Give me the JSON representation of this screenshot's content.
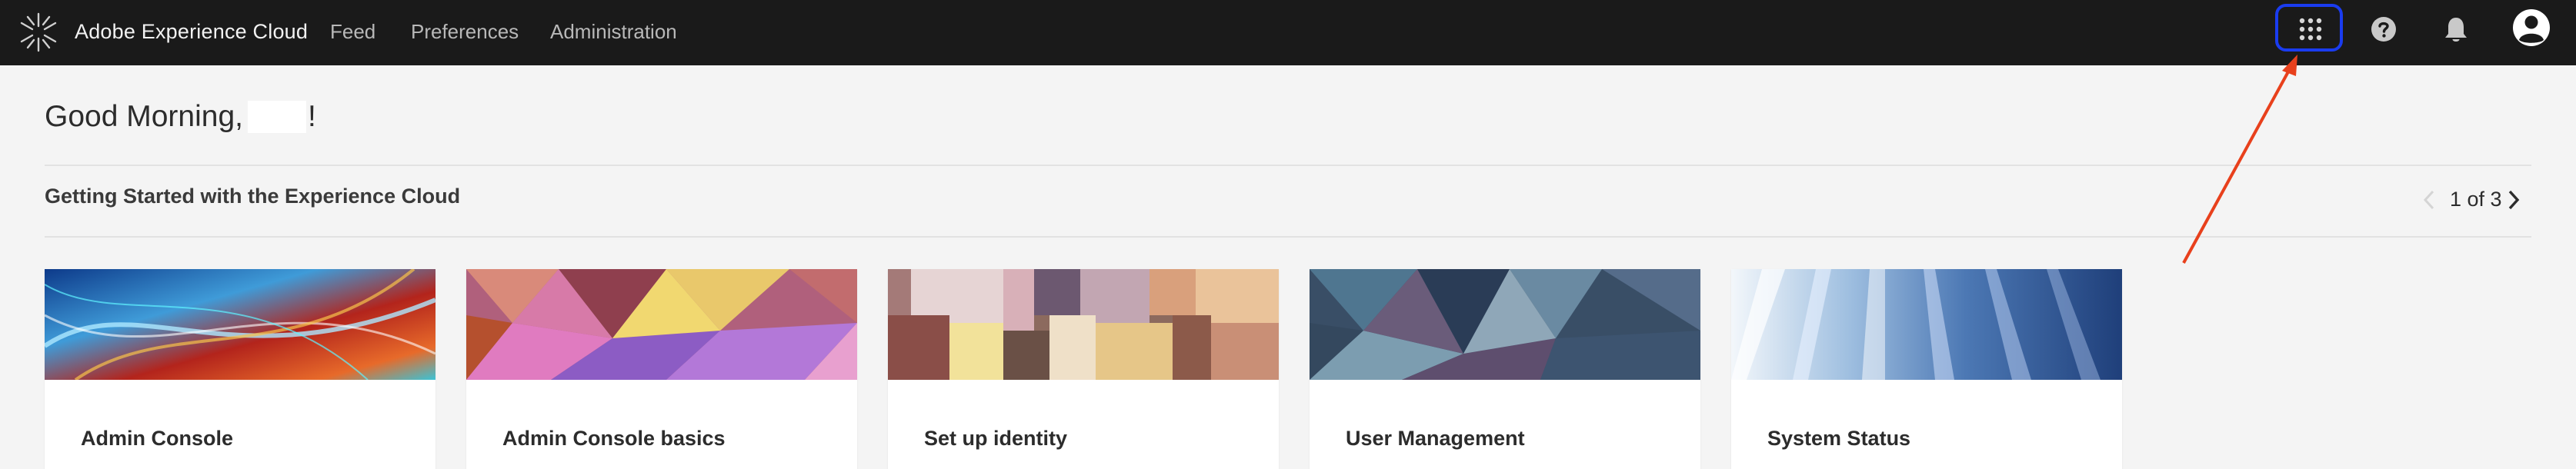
{
  "header": {
    "logo_icon": "adobe-experience-cloud-logo",
    "brand": "Adobe Experience Cloud",
    "nav": [
      {
        "label": "Feed"
      },
      {
        "label": "Preferences"
      },
      {
        "label": "Administration"
      }
    ],
    "icons": {
      "apps": "apps-grid-icon",
      "help": "help-icon",
      "notifications": "bell-icon",
      "profile": "user-avatar-icon"
    }
  },
  "greeting": {
    "prefix": "Good Morning,",
    "suffix": "!"
  },
  "section": {
    "title": "Getting Started with the Experience Cloud",
    "pager": "1 of 3"
  },
  "cards": [
    {
      "title": "Admin Console"
    },
    {
      "title": "Admin Console basics"
    },
    {
      "title": "Set up identity"
    },
    {
      "title": "User Management"
    },
    {
      "title": "System Status"
    }
  ],
  "colors": {
    "topbar": "#1a1a1a",
    "background": "#f4f4f4",
    "highlight": "#1a3cf0",
    "annotation_arrow": "#e8401c"
  }
}
